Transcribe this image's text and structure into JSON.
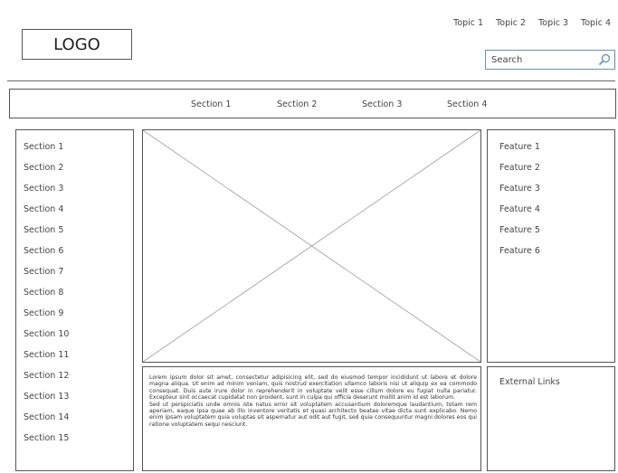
{
  "header": {
    "logo": "LOGO",
    "topics": [
      "Topic 1",
      "Topic 2",
      "Topic 3",
      "Topic 4"
    ],
    "search_value": "Search"
  },
  "section_nav": [
    "Section 1",
    "Section 2",
    "Section 3",
    "Section 4"
  ],
  "left_nav": [
    "Section 1",
    "Section 2",
    "Section 3",
    "Section 4",
    "Section 5",
    "Section 6",
    "Section 7",
    "Section 8",
    "Section 9",
    "Section 10",
    "Section 11",
    "Section 12",
    "Section 13",
    "Section 14",
    "Section 15"
  ],
  "features": [
    "Feature 1",
    "Feature 2",
    "Feature 3",
    "Feature 4",
    "Feature 5",
    "Feature 6"
  ],
  "body_text": {
    "p1": "Lorem ipsum dolor sit amet, consectetur adipisicing elit, sed do eiusmod tempor incididunt ut labore et dolore magna aliqua. Ut enim ad minim veniam, quis nostrud exercitation ullamco laboris nisi ut aliquip ex ea commodo consequat. Duis aute irure dolor in reprehenderit in voluptate velit esse cillum dolore eu fugiat nulla pariatur. Excepteur sint occaecat cupidatat non proident, sunt in culpa qui officia deserunt mollit anim id est laborum.",
    "p2": "Sed ut perspiciatis unde omnis iste natus error sit voluptatem accusantium doloremque laudantium, totam rem aperiam, eaque ipsa quae ab illo inventore veritatis et quasi architecto beatae vitae dicta sunt explicabo. Nemo enim ipsam voluptatem quia voluptas sit aspernatur aut odit aut fugit, sed quia consequuntur magni dolores eos qui ratione voluptatem sequi nesciunt."
  },
  "external_links": "External Links"
}
